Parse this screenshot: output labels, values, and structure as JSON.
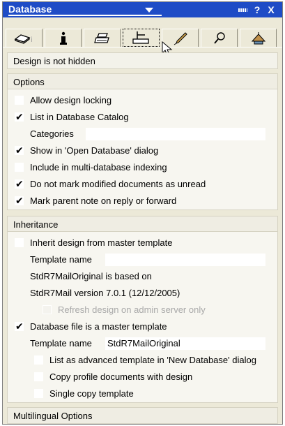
{
  "titlebar": {
    "title": "Database",
    "help_label": "?",
    "close_label": "X"
  },
  "tabs": [
    {
      "icon": "database-icon"
    },
    {
      "icon": "info-icon"
    },
    {
      "icon": "printer-icon"
    },
    {
      "icon": "design-icon",
      "active": true
    },
    {
      "icon": "pen-icon"
    },
    {
      "icon": "search-icon"
    },
    {
      "icon": "launch-icon"
    }
  ],
  "status": {
    "text": "Design is not hidden"
  },
  "options": {
    "header": "Options",
    "allow_design_locking": {
      "label": "Allow design locking",
      "checked": false
    },
    "list_in_catalog": {
      "label": "List in Database Catalog",
      "checked": true
    },
    "categories": {
      "label": "Categories",
      "value": ""
    },
    "show_in_open_dialog": {
      "label": "Show in 'Open Database' dialog",
      "checked": true
    },
    "include_multidb": {
      "label": "Include in multi-database indexing",
      "checked": false
    },
    "do_not_mark_unread": {
      "label": "Do not mark modified documents as unread",
      "checked": true
    },
    "mark_parent_note": {
      "label": "Mark parent note on reply or forward",
      "checked": true
    }
  },
  "inheritance": {
    "header": "Inheritance",
    "inherit_design": {
      "label": "Inherit design from master template",
      "checked": false
    },
    "template_name_1": {
      "label": "Template name",
      "value": ""
    },
    "based_on_line1": "StdR7MailOriginal is based on",
    "based_on_line2": "StdR7Mail version 7.0.1 (12/12/2005)",
    "refresh_design": {
      "label": "Refresh design on admin server only",
      "checked": false,
      "disabled": true
    },
    "is_master_template": {
      "label": "Database file is a master template",
      "checked": true
    },
    "template_name_2": {
      "label": "Template name",
      "value": "StdR7MailOriginal"
    },
    "list_advanced": {
      "label": "List as advanced template in 'New Database' dialog",
      "checked": false
    },
    "copy_profile": {
      "label": "Copy profile documents with design",
      "checked": false
    },
    "single_copy": {
      "label": "Single copy template",
      "checked": false
    }
  },
  "multilingual": {
    "header": "Multilingual Options"
  },
  "check_glyph": "✔"
}
